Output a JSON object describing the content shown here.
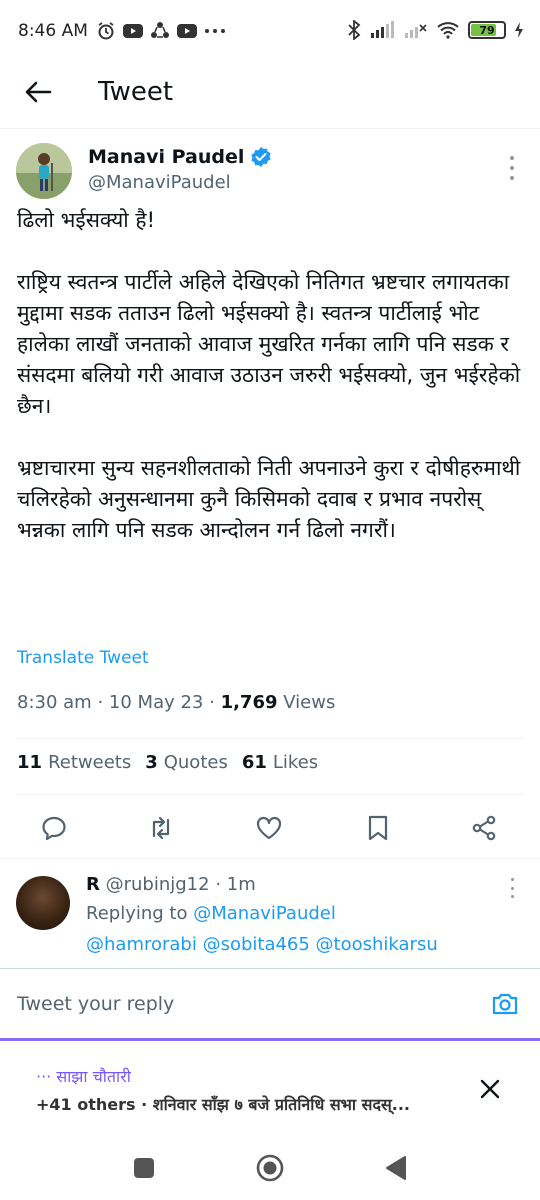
{
  "status_bar": {
    "time": "8:46 AM",
    "battery": "79",
    "battery_level": 0.79
  },
  "header": {
    "title": "Tweet"
  },
  "tweet": {
    "author_name": "Manavi Paudel",
    "author_handle": "@ManaviPaudel",
    "paragraphs": [
      "ढिलो भईसक्यो है!",
      "राष्ट्रिय स्वतन्त्र पार्टीले अहिले देखिएको नितिगत भ्रष्टचार लगायतका मुद्दामा सडक तताउन ढिलो भईसक्यो है। स्वतन्त्र पार्टीलाई भोट हालेका लाखौं जनताको आवाज मुखरित गर्नका लागि पनि सडक र संसदमा बलियो गरी आवाज उठाउन जरुरी भईसक्यो, जुन भईरहेको छैन।",
      "भ्रष्टाचारमा सुन्य सहनशीलताको निती अपनाउने कुरा र दोषीहरुमाथी चलिरहेको अनुसन्धानमा कुनै किसिमको दवाब र प्रभाव नपरोस् भन्नका लागि पनि सडक आन्दोलन गर्न ढिलो नगरौं।"
    ],
    "translate_label": "Translate Tweet",
    "time": "8:30 am",
    "date": "10 May 23",
    "views_count": "1,769",
    "views_label": "Views",
    "retweets_count": "11",
    "retweets_label": "Retweets",
    "quotes_count": "3",
    "quotes_label": "Quotes",
    "likes_count": "61",
    "likes_label": "Likes"
  },
  "reply": {
    "name": "R",
    "handle": "@rubinjg12",
    "time": "1m",
    "replying_to_label": "Replying to",
    "replying_to_handle": "@ManaviPaudel",
    "mentions": "@hamrorabi @sobita465 @tooshikarsu"
  },
  "composer": {
    "placeholder": "Tweet your reply"
  },
  "spaces": {
    "title": "··· साझा चौतारी",
    "subtitle": "+41 others · शनिवार साँझ ७ बजे प्रतिनिधि सभा सदस्..."
  },
  "colors": {
    "accent": "#1d9bf0",
    "spaces_purple": "#7856ff",
    "text_primary": "#0f1419",
    "text_secondary": "#536471"
  }
}
